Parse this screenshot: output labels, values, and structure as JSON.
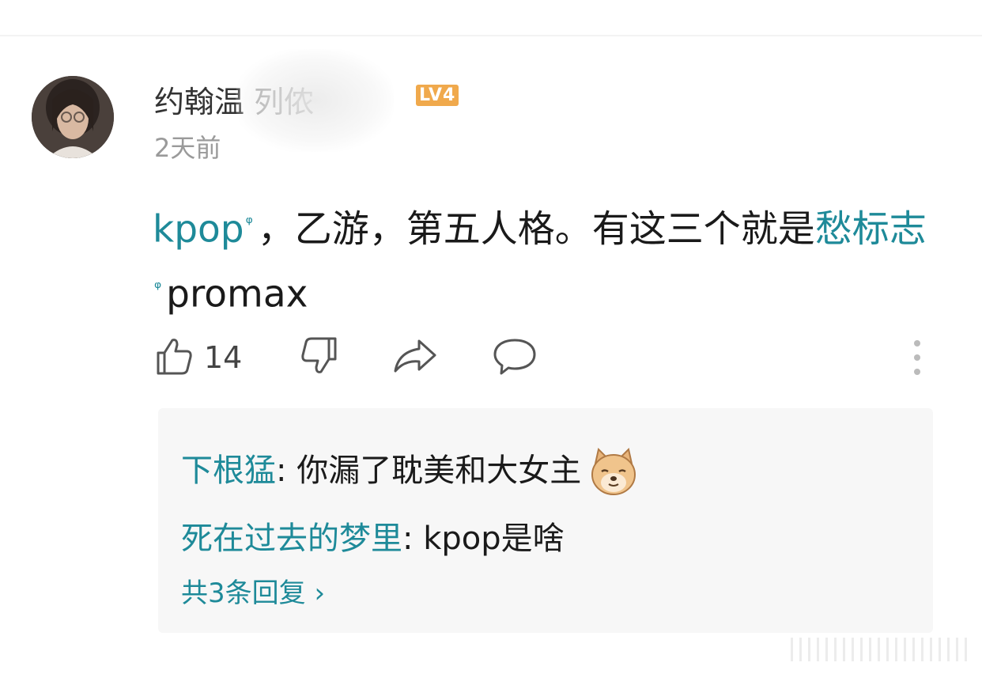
{
  "comment": {
    "username": "约翰温  列侬",
    "level_badge": "LV4",
    "timestamp": "2天前",
    "body": {
      "link1": "kpop",
      "text1": "，乙游，第五人格。有这三个就是",
      "link2": "愁标志",
      "text2": "promax"
    },
    "search_icon_glyph": "ᵠ",
    "likes": "14"
  },
  "replies": [
    {
      "author": "下根猛",
      "separator": ": ",
      "text": "你漏了耽美和大女主",
      "emoji": "doge-face"
    },
    {
      "author": "死在过去的梦里",
      "separator": ": ",
      "text": "kpop是啥"
    }
  ],
  "view_replies": "共3条回复 ›",
  "colors": {
    "link": "#1e8a99",
    "badge": "#f0a94c",
    "muted": "#9a9a9a"
  }
}
